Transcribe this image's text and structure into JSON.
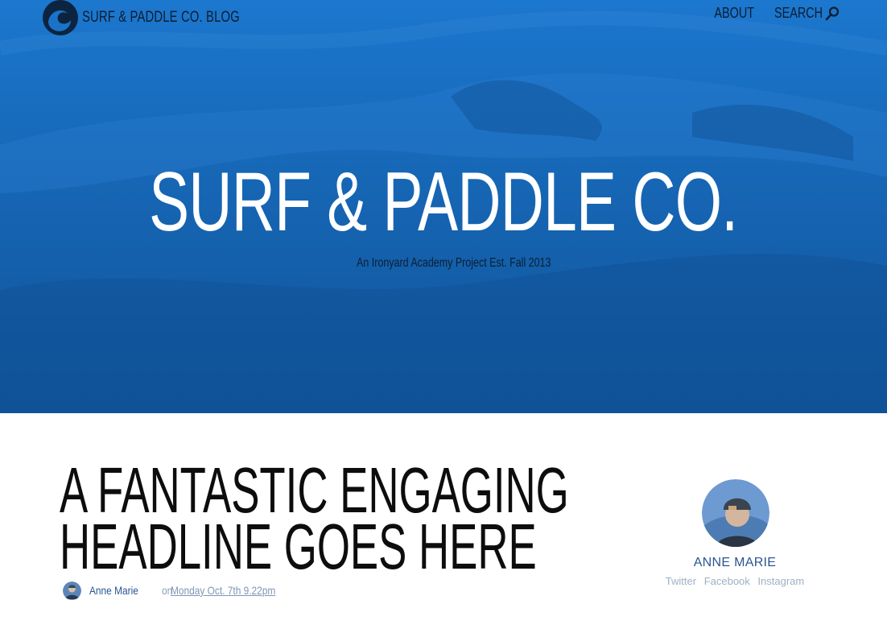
{
  "site": {
    "logo_text": "SURF & PADDLE CO. BLOG",
    "nav": [
      {
        "label": "ABOUT"
      },
      {
        "label": "SEARCH"
      }
    ],
    "search_icon": "search-icon"
  },
  "hero": {
    "title": "SURF & PADDLE CO.",
    "subtitle": "An Ironyard Academy Project Est. Fall 2013"
  },
  "article": {
    "headline_line1": "A FANTASTIC ENGAGING",
    "headline_line2": "HEADLINE GOES HERE",
    "author": "Anne Marie",
    "on": "on",
    "date": "Monday Oct. 7th 9.22pm"
  },
  "sidebar": {
    "name": "ANNE MARIE",
    "social": [
      {
        "label": "Twitter"
      },
      {
        "label": "Facebook"
      },
      {
        "label": "Instagram"
      }
    ]
  },
  "colors": {
    "hero_blue": "#1a73c8",
    "link_blue": "#2a5590",
    "muted_link": "#9fb0c6"
  }
}
